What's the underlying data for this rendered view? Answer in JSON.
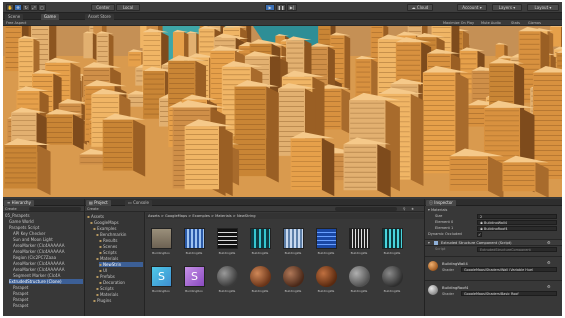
{
  "toolbar": {
    "pivot_label": "Center",
    "space_label": "Local",
    "play_icon": "play-icon",
    "pause_icon": "pause-icon",
    "step_icon": "step-icon",
    "cloud_label": "Cloud",
    "account_label": "Account",
    "layers_label": "Layers",
    "layout_label": "Layout"
  },
  "top_tabs": {
    "scene": "Scene",
    "game": "Game",
    "asset_store": "Asset Store"
  },
  "game_bar": {
    "display": "Free Aspect",
    "maximize": "Maximize On Play",
    "mute": "Mute Audio",
    "stats": "Stats",
    "gizmos": "Gizmos"
  },
  "hierarchy": {
    "title": "Hierarchy",
    "create": "Create",
    "items": [
      {
        "label": "05_Parapets"
      },
      {
        "label": "Game World"
      },
      {
        "label": "Parapets Script"
      },
      {
        "label": "API Key Checker"
      },
      {
        "label": "Sun and Moon Light"
      },
      {
        "label": "AreaMarker (Clc4AAAAAA"
      },
      {
        "label": "AreaMarker (Clc4AAAAAA"
      },
      {
        "label": "Region (Clc2PC7Zaaa"
      },
      {
        "label": "AreaMarker (Clc4AAAAAA"
      },
      {
        "label": "AreaMarker (Clc4AAAAAA"
      },
      {
        "label": "Segment Marker (Clc4A"
      },
      {
        "label": "ExtrudedStructure (Clone)"
      },
      {
        "label": "Parapet"
      },
      {
        "label": "Parapet"
      },
      {
        "label": "Parapet"
      },
      {
        "label": "Parapet"
      }
    ]
  },
  "project": {
    "title": "Project",
    "console_tab": "Console",
    "create": "Create",
    "tree": [
      {
        "label": "Assets"
      },
      {
        "label": "GoogleMaps"
      },
      {
        "label": "Examples"
      },
      {
        "label": "Benchmarkin"
      },
      {
        "label": "Results"
      },
      {
        "label": "Scenes"
      },
      {
        "label": "Scripts"
      },
      {
        "label": "Materials"
      },
      {
        "label": "NewStrin"
      },
      {
        "label": "UI"
      },
      {
        "label": "Prefabs"
      },
      {
        "label": "Decoration"
      },
      {
        "label": "Scripts"
      },
      {
        "label": "Materials"
      },
      {
        "label": "Plugins"
      }
    ],
    "breadcrumb": "Assets > GoogleMaps > Examples > Materials > NewString",
    "assets_row1": [
      {
        "label": "BuildingRoo"
      },
      {
        "label": "BuildingWa"
      },
      {
        "label": "BuildingWa"
      },
      {
        "label": "BuildingWa"
      },
      {
        "label": "BuildingWa"
      },
      {
        "label": "BuildingWa"
      },
      {
        "label": "BuildingWa"
      },
      {
        "label": "BuildingWa"
      }
    ],
    "assets_row2": [
      {
        "label": "BuildingRoo"
      },
      {
        "label": "BuildingRoo"
      },
      {
        "label": "BuildingWa"
      },
      {
        "label": "BuildingWa"
      },
      {
        "label": "BuildingWa"
      },
      {
        "label": "BuildingWa"
      },
      {
        "label": "BuildingWa"
      },
      {
        "label": "BuildingWa"
      }
    ]
  },
  "inspector": {
    "title": "Inspector",
    "materials_label": "Materials",
    "size_label": "Size",
    "size_value": "2",
    "element0_label": "Element 0",
    "element0_value": "BuildingWall4",
    "element1_label": "Element 1",
    "element1_value": "BuildingRoof4",
    "dynamic_occluded": "Dynamic Occluded",
    "component_title": "Extruded Structure Component (Script)",
    "script_label": "Script",
    "script_value": "ExtrudedStructureComponent",
    "mat1_name": "BuildingWall4",
    "mat1_shader_label": "Shader",
    "mat1_shader_value": "GoogleMaps/Shaders/Wall (Variable Hue)",
    "mat2_name": "BuildingRoof4",
    "mat2_shader_label": "Shader",
    "mat2_shader_value": "GoogleMaps/Shaders/Basic Roof"
  }
}
